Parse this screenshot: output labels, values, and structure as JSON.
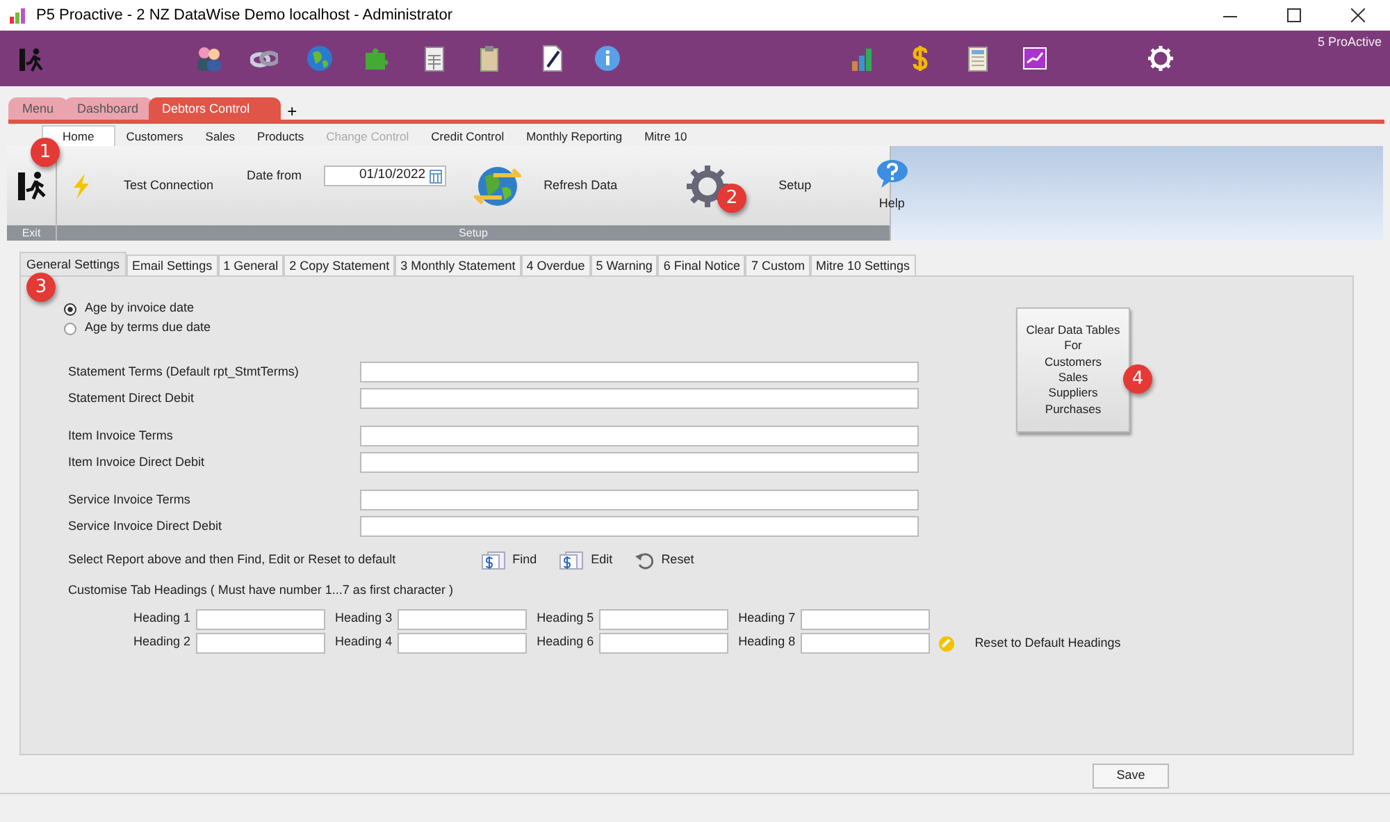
{
  "window": {
    "title": "P5 Proactive - 2 NZ DataWise Demo localhost - Administrator"
  },
  "toolbar": {
    "brand": "5 ProActive"
  },
  "app_tabs": [
    {
      "label": "Menu",
      "selected": false
    },
    {
      "label": "Dashboard",
      "selected": false
    },
    {
      "label": "Debtors Control",
      "selected": true
    }
  ],
  "add_tab": "+",
  "ribbon_tabs": [
    {
      "label": "Home",
      "selected": true,
      "disabled": false
    },
    {
      "label": "Customers",
      "selected": false,
      "disabled": false
    },
    {
      "label": "Sales",
      "selected": false,
      "disabled": false
    },
    {
      "label": "Products",
      "selected": false,
      "disabled": false
    },
    {
      "label": "Change Control",
      "selected": false,
      "disabled": true
    },
    {
      "label": "Credit Control",
      "selected": false,
      "disabled": false
    },
    {
      "label": "Monthly Reporting",
      "selected": false,
      "disabled": false
    },
    {
      "label": "Mitre 10",
      "selected": false,
      "disabled": false
    }
  ],
  "ribbon": {
    "test_connection": "Test Connection",
    "date_label": "Date from",
    "date_value": "01/10/2022",
    "refresh": "Refresh Data",
    "setup": "Setup",
    "help": "Help",
    "group_exit": "Exit",
    "group_setup": "Setup"
  },
  "settings_tabs": [
    {
      "label": "General Settings",
      "selected": true
    },
    {
      "label": "Email Settings",
      "selected": false
    },
    {
      "label": "1 General",
      "selected": false
    },
    {
      "label": "2 Copy Statement",
      "selected": false
    },
    {
      "label": "3 Monthly Statement",
      "selected": false
    },
    {
      "label": "4 Overdue",
      "selected": false
    },
    {
      "label": "5 Warning",
      "selected": false
    },
    {
      "label": "6 Final Notice",
      "selected": false
    },
    {
      "label": "7 Custom",
      "selected": false
    },
    {
      "label": "Mitre 10 Settings",
      "selected": false
    }
  ],
  "aging": [
    {
      "label": "Age by invoice date",
      "selected": true
    },
    {
      "label": "Age by terms due date",
      "selected": false
    }
  ],
  "term_groups": [
    {
      "fields": [
        {
          "label": "Statement Terms (Default rpt_StmtTerms)"
        },
        {
          "label": "Statement Direct Debit"
        }
      ]
    },
    {
      "fields": [
        {
          "label": "Item Invoice Terms"
        },
        {
          "label": "Item Invoice Direct Debit"
        }
      ]
    },
    {
      "fields": [
        {
          "label": "Service Invoice Terms"
        },
        {
          "label": "Service Invoice Direct Debit"
        }
      ]
    }
  ],
  "report_actions": {
    "prompt": "Select Report above and then Find, Edit or Reset to default",
    "buttons": [
      {
        "label": "Find",
        "kind": "report"
      },
      {
        "label": "Edit",
        "kind": "report"
      },
      {
        "label": "Reset",
        "kind": "reset"
      }
    ]
  },
  "headings": {
    "title": "Customise Tab Headings ( Must have number 1...7 as first character )",
    "fields": [
      {
        "label": "Heading 1"
      },
      {
        "label": "Heading 3"
      },
      {
        "label": "Heading 5"
      },
      {
        "label": "Heading 7"
      },
      {
        "label": "Heading 2"
      },
      {
        "label": "Heading 4"
      },
      {
        "label": "Heading 6"
      },
      {
        "label": "Heading 8"
      }
    ],
    "reset": "Reset to Default Headings"
  },
  "clear_button": [
    "Clear Data Tables",
    "For",
    "Customers",
    "Sales",
    "Suppliers",
    "Purchases"
  ],
  "save": "Save",
  "markers": [
    "1",
    "2",
    "3",
    "4"
  ]
}
